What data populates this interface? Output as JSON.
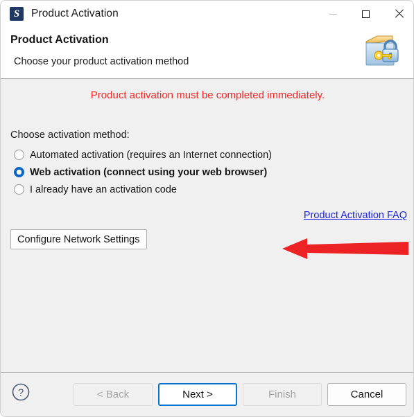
{
  "window": {
    "title": "Product Activation",
    "icon": "app-logo-icon",
    "controls": {
      "minimize": "minimize-icon",
      "maximize": "maximize-icon",
      "close": "close-icon"
    }
  },
  "header": {
    "title": "Product Activation",
    "subtitle": "Choose your product activation method",
    "icon": "box-with-padlock-and-key-icon"
  },
  "main": {
    "warning": "Product activation must be completed immediately.",
    "warning_color": "#f42626",
    "prompt": "Choose activation method:",
    "options": [
      {
        "label": "Automated activation (requires an Internet connection)",
        "selected": false
      },
      {
        "label": "Web activation (connect using your web browser)",
        "selected": true
      },
      {
        "label": "I already have an activation code",
        "selected": false
      }
    ],
    "faq_link": "Product Activation FAQ",
    "faq_link_color": "#1a22dd",
    "network_button": "Configure Network Settings",
    "annotation": {
      "type": "arrow",
      "direction": "left",
      "color": "#ed2224",
      "points_at": "Web activation (connect using your web browser)"
    }
  },
  "footer": {
    "help": "help-icon",
    "buttons": [
      {
        "label": "< Back",
        "state": "disabled"
      },
      {
        "label": "Next >",
        "state": "focused"
      },
      {
        "label": "Finish",
        "state": "disabled"
      },
      {
        "label": "Cancel",
        "state": "normal"
      }
    ]
  }
}
